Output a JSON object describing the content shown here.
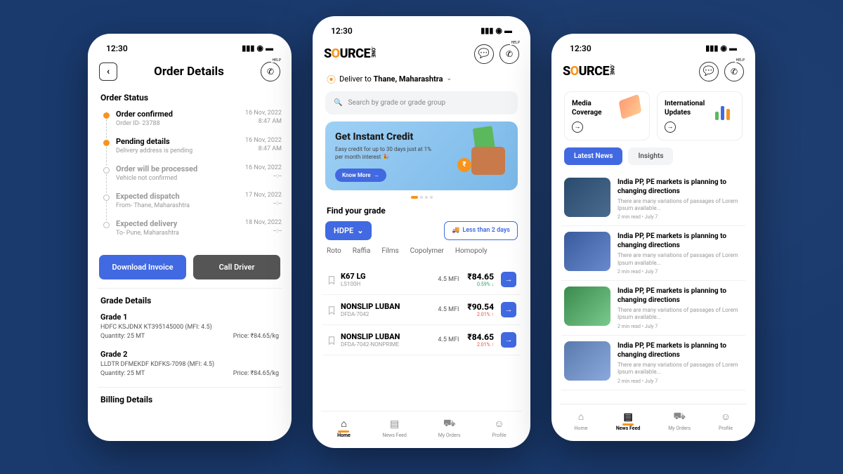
{
  "statusbar": {
    "time": "12:30"
  },
  "left": {
    "title": "Order Details",
    "status_label": "Order Status",
    "timeline": [
      {
        "title": "Order confirmed",
        "sub": "Order ID- 23788",
        "date": "16 Nov, 2022",
        "time": "8:47 AM",
        "active": true
      },
      {
        "title": "Pending details",
        "sub": "Delivery address is pending",
        "date": "16 Nov, 2022",
        "time": "8:47 AM",
        "active": true
      },
      {
        "title": "Order will be processed",
        "sub": "Vehicle not confirmed",
        "date": "16 Nov, 2022",
        "time": "--:--",
        "active": false
      },
      {
        "title": "Expected dispatch",
        "sub": "From- Thane, Maharashtra",
        "date": "17 Nov, 2022",
        "time": "--:--",
        "active": false
      },
      {
        "title": "Expected delivery",
        "sub": "To- Pune, Maharashtra",
        "date": "18 Nov, 2022",
        "time": "--:--",
        "active": false
      }
    ],
    "btn_invoice": "Download Invoice",
    "btn_call": "Call Driver",
    "grade_label": "Grade Details",
    "grades": [
      {
        "title": "Grade 1",
        "code": "HDFC KSJDNX KT395145000 (MFI: 4.5)",
        "qty": "Quantity: 25 MT",
        "price": "Price: ₹84.65/kg"
      },
      {
        "title": "Grade 2",
        "code": "LLDTR DFMEKDF KDFKS-7098 (MFI: 4.5)",
        "qty": "Quantity: 25 MT",
        "price": "Price: ₹84.65/kg"
      }
    ],
    "billing_label": "Billing Details"
  },
  "center": {
    "logo_a": "S",
    "logo_o": "O",
    "logo_b": "URCE",
    "logo_dot": ".ONE",
    "deliver_prefix": "Deliver to ",
    "deliver_loc": "Thane, Maharashtra",
    "search_placeholder": "Search by grade or grade group",
    "banner_title": "Get Instant Credit",
    "banner_sub": "Easy credit for up to 30 days just at 1% per month interest 🎉",
    "banner_btn": "Know More",
    "find_label": "Find your grade",
    "grade_chip": "HDPE",
    "days_chip": "Less than 2 days",
    "sub_tabs": [
      "Roto",
      "Raffia",
      "Films",
      "Copolymer",
      "Homopoly"
    ],
    "products": [
      {
        "name": "K67 LG",
        "code": "LS100H",
        "mfi": "4.5 MFI",
        "price": "₹84.65",
        "change": "0.59% ↓",
        "dir": "down"
      },
      {
        "name": "NONSLIP LUBAN",
        "code": "DFDA-7042",
        "mfi": "4.5 MFI",
        "price": "₹90.54",
        "change": "2.01% ↑",
        "dir": "up"
      },
      {
        "name": "NONSLIP LUBAN",
        "code": "DFDA-7042-NONPRIME",
        "mfi": "4.5 MFI",
        "price": "₹84.65",
        "change": "2.01% ↑",
        "dir": "up"
      }
    ],
    "tabs": [
      "Home",
      "News Feed",
      "My Orders",
      "Profile"
    ],
    "active_tab": 0
  },
  "right": {
    "tile1": "Media Coverage",
    "tile2": "International Updates",
    "pill1": "Latest News",
    "pill2": "Insights",
    "news": [
      {
        "title": "India PP, PE markets is planning to changing directions",
        "sub": "There are many variations of passages of Lorem Ipsum available...",
        "meta": "2 min read  •  July 7"
      },
      {
        "title": "India PP, PE markets is planning to changing directions",
        "sub": "There are many variations of passages of Lorem Ipsum available...",
        "meta": "2 min read  •  July 7"
      },
      {
        "title": "India PP, PE markets is planning to changing directions",
        "sub": "There are many variations of passages of Lorem Ipsum available...",
        "meta": "2 min read  •  July 7"
      },
      {
        "title": "India PP, PE markets is planning to changing directions",
        "sub": "There are many variations of passages of Lorem Ipsum available...",
        "meta": "2 min read  •  July 7"
      }
    ],
    "tabs": [
      "Home",
      "News Feed",
      "My Orders",
      "Profile"
    ],
    "active_tab": 1
  }
}
